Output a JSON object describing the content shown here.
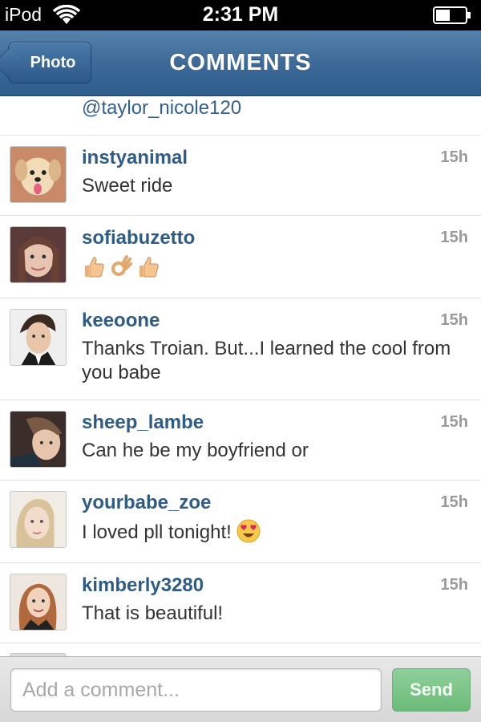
{
  "status_bar": {
    "carrier": "iPod",
    "time": "2:31 PM"
  },
  "nav": {
    "back_label": "Photo",
    "title": "COMMENTS"
  },
  "first_partial": {
    "mention": "@taylor_nicole120"
  },
  "comments": [
    {
      "username": "instyanimal",
      "time": "15h",
      "text": "Sweet ride",
      "avatar": "puppy-avatar"
    },
    {
      "username": "sofiabuzetto",
      "time": "15h",
      "text": "",
      "emojis": [
        "thumbs-up-emoji",
        "ok-hand-emoji",
        "thumbs-up-emoji"
      ],
      "avatar": "woman-avatar"
    },
    {
      "username": "keeoone",
      "time": "15h",
      "text": "Thanks Troian. But...I learned the cool from you babe",
      "avatar": "man-avatar"
    },
    {
      "username": "sheep_lambe",
      "time": "15h",
      "text": "Can he be my boyfriend or",
      "avatar": "girl-avatar"
    },
    {
      "username": "yourbabe_zoe",
      "time": "15h",
      "text": "I loved pll tonight!",
      "emojis": [
        "heart-eyes-emoji"
      ],
      "avatar": "blonde-avatar"
    },
    {
      "username": "kimberly3280",
      "time": "15h",
      "text": "That is beautiful!",
      "avatar": "redhead-avatar"
    }
  ],
  "comment_bar": {
    "placeholder": "Add a comment...",
    "send_label": "Send"
  },
  "colors": {
    "nav_blue": "#3d6a98",
    "username_blue": "#2f5b87",
    "send_green": "#7cc488",
    "time_gray": "#9a9a9a"
  }
}
